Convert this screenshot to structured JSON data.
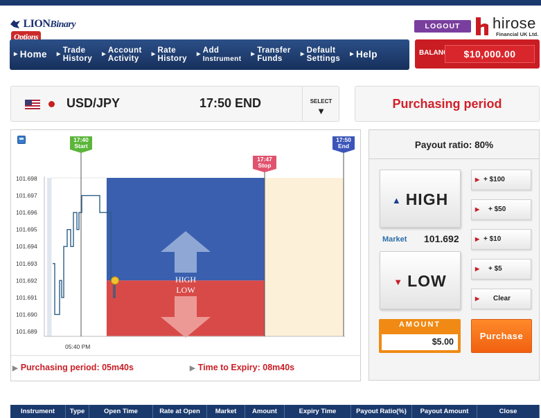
{
  "header": {
    "logo": {
      "lion": "LION",
      "binary": "Binary",
      "options": "Options"
    },
    "logout_label": "LOGOUT",
    "broker": {
      "name": "hirose",
      "sub": "Financial UK Ltd."
    },
    "balance_label": "BALANCE",
    "balance_value": "$10,000.00"
  },
  "nav": {
    "items": [
      {
        "line1": "Home",
        "line2": ""
      },
      {
        "line1": "Trade",
        "line2": "History"
      },
      {
        "line1": "Account",
        "line2": "Activity"
      },
      {
        "line1": "Rate",
        "line2": "History"
      },
      {
        "line1": "Add",
        "line2": "Instrument"
      },
      {
        "line1": "Transfer",
        "line2": "Funds"
      },
      {
        "line1": "Default",
        "line2": "Settings"
      },
      {
        "line1": "Help",
        "line2": ""
      }
    ]
  },
  "instrument": {
    "pair": "USD/JPY",
    "end_time": "17:50 END",
    "select_label": "SELECT",
    "status": "Purchasing period"
  },
  "chart": {
    "start_label": "17:40",
    "start_sub": "Start",
    "stop_label": "17:47",
    "stop_sub": "Stop",
    "end_label": "17:50",
    "end_sub": "End",
    "y_ticks": [
      "101.698",
      "101.697",
      "101.696",
      "101.695",
      "101.694",
      "101.693",
      "101.692",
      "101.691",
      "101.690",
      "101.689"
    ],
    "x_tick": "05:40 PM",
    "high_text": "HIGH",
    "low_text": "LOW",
    "current_rate": 101.692,
    "colors": {
      "high": "#3a5fae",
      "low": "#d84a48",
      "future": "#fcf0d8",
      "line": "#2b5d86"
    }
  },
  "info": {
    "purchasing_period": "Purchasing period: 05m40s",
    "time_to_expiry": "Time to Expiry: 08m40s"
  },
  "trade": {
    "payout_ratio": "Payout ratio:  80%",
    "high_label": "HIGH",
    "low_label": "LOW",
    "market_label": "Market",
    "market_value": "101.692",
    "amount_buttons": [
      "+ $100",
      "+ $50",
      "+ $10",
      "+ $5",
      "Clear"
    ],
    "amount_label": "AMOUNT",
    "amount_value": "$5.00",
    "purchase_label": "Purchase"
  },
  "table": {
    "headers": [
      "Instrument",
      "Type",
      "Open Time",
      "Rate at Open",
      "Market",
      "Amount",
      "Expiry Time",
      "Payout Ratio(%)",
      "Payout Amount",
      "Close"
    ]
  }
}
